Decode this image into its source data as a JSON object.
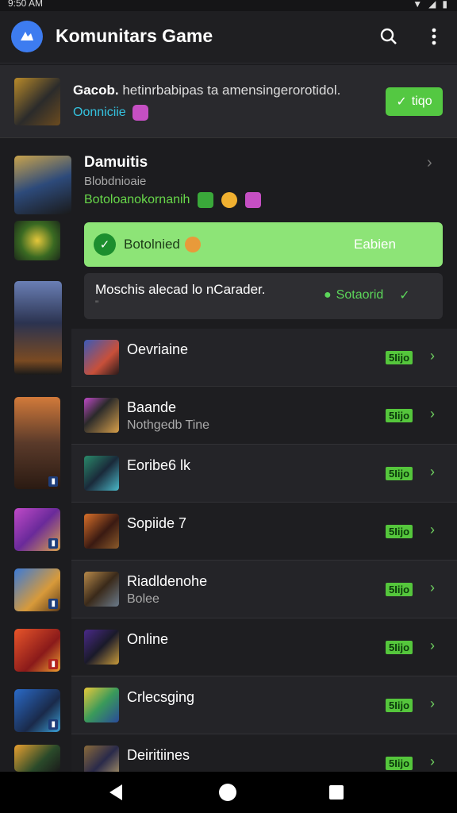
{
  "status": {
    "time": "9:50 AM",
    "icons": [
      "wifi-icon",
      "signal-icon",
      "battery-icon"
    ]
  },
  "appbar": {
    "title": "Komunitars Game"
  },
  "banner": {
    "text_bold": "Gacob.",
    "text": " hetinrbabipas ta amensingerorotidol.",
    "sub": "Oonniciie",
    "button": "tiqo"
  },
  "detail": {
    "title": "Damuitis",
    "subtitle": "Blobdnioaie",
    "tags": "Botoloanokornanih",
    "arrow": "›"
  },
  "green_card": {
    "label": "Botolnied",
    "cta": "Eabien"
  },
  "notice": {
    "text": "Moschis alecad lo nCarader.",
    "subtext": "\"",
    "status": "Sotaorid"
  },
  "list": [
    {
      "name": "Oevriaine",
      "sub": "",
      "price": "5Iijo"
    },
    {
      "name": "Baande",
      "sub": "Nothgedb Tine",
      "price": "5Iijo"
    },
    {
      "name": "Eoribe6 lk",
      "sub": "",
      "price": "5Iijo"
    },
    {
      "name": "Sopiide 7",
      "sub": "",
      "price": "5Iijo"
    },
    {
      "name": "Riadldenohe",
      "sub": "Bolee",
      "price": "5Iijo"
    },
    {
      "name": "Online",
      "sub": "",
      "price": "5Iijo"
    },
    {
      "name": "Crlecsging",
      "sub": "",
      "price": "5Iijo"
    },
    {
      "name": "Deiritiines",
      "sub": "",
      "price": "5Iijo"
    }
  ],
  "colors": {
    "accent": "#54c842",
    "background": "#1c1c1f",
    "brand_blue": "#3d7cf0"
  }
}
